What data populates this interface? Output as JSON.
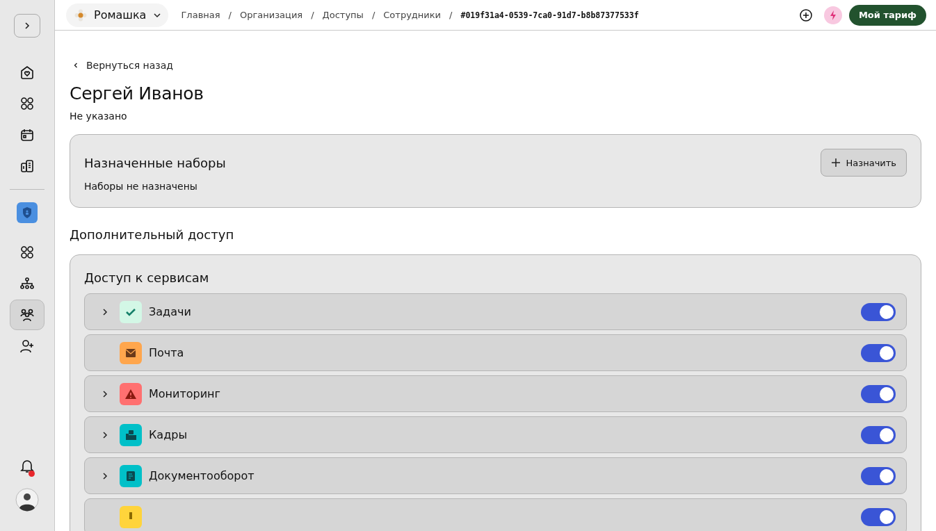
{
  "sidebar": {
    "items": [
      {
        "kind": "home",
        "selected": false
      },
      {
        "kind": "apps",
        "selected": false
      },
      {
        "kind": "calendar",
        "selected": false
      },
      {
        "kind": "buildings",
        "selected": false
      }
    ],
    "app": {
      "kind": "shield"
    },
    "app_items": [
      {
        "kind": "apps",
        "selected": false
      },
      {
        "kind": "org",
        "selected": false
      },
      {
        "kind": "people",
        "selected": true
      },
      {
        "kind": "user-add",
        "selected": false
      }
    ],
    "notifications": {
      "unread": true
    }
  },
  "topbar": {
    "org": "Ромашка",
    "breadcrumbs": [
      {
        "label": "Главная"
      },
      {
        "separator": "/",
        "label": "Организация"
      },
      {
        "separator": "/",
        "label": "Доступы"
      },
      {
        "separator": "/",
        "label": "Сотрудники"
      },
      {
        "separator": "/",
        "label": "#019f31a4-0539-7ca0-91d7-b8b87377533f"
      }
    ],
    "plan_button": "Мой тариф"
  },
  "back_link": "Вернуться назад",
  "title": "Сергей Иванов",
  "subtitle": "Не указано",
  "assigned_sets": {
    "title": "Назначенные наборы",
    "button": "Назначить",
    "empty": "Наборы не назначены"
  },
  "extra_access": {
    "title": "Дополнительный доступ",
    "services_title": "Доступ к сервисам",
    "services": [
      {
        "name": "Задачи",
        "kind": "check",
        "color": "#d3f7e6",
        "expandable": true,
        "on": true
      },
      {
        "name": "Почта",
        "kind": "mail",
        "color": "#ffa64d",
        "expandable": false,
        "on": true
      },
      {
        "name": "Мониторинг",
        "kind": "warning",
        "color": "#ff7070",
        "expandable": true,
        "on": true
      },
      {
        "name": "Кадры",
        "kind": "hr",
        "color": "#00c0c8",
        "expandable": true,
        "on": true
      },
      {
        "name": "Документооборот",
        "kind": "doc",
        "color": "#00c0c8",
        "expandable": true,
        "on": true
      },
      {
        "kind": "key",
        "color": "#ffd43b",
        "on": true
      }
    ]
  }
}
